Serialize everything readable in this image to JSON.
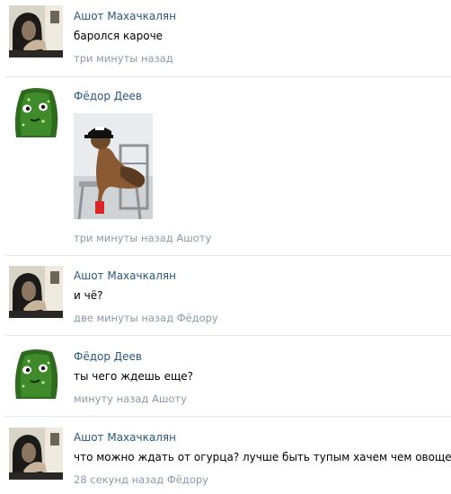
{
  "comments": [
    {
      "author": "Ашот Махачкалян",
      "text": "баролся кароче",
      "time": "три минуты назад",
      "reply_to": "",
      "avatar_icon": "man-dark-photo-avatar"
    },
    {
      "author": "Фёдор Деев",
      "text": "",
      "attachment_icon": "cat-in-cap-on-chair-photo",
      "time": "три минуты назад",
      "reply_to": "Ашоту",
      "avatar_icon": "cucumber-face-avatar"
    },
    {
      "author": "Ашот Махачкалян",
      "text": "и чё?",
      "time": "две минуты назад",
      "reply_to": "Фёдору",
      "avatar_icon": "man-dark-photo-avatar"
    },
    {
      "author": "Фёдор Деев",
      "text": "ты чего ждешь еще?",
      "time": "минуту назад",
      "reply_to": "Ашоту",
      "avatar_icon": "cucumber-face-avatar"
    },
    {
      "author": "Ашот Махачкалян",
      "text": "что можно ждать от огурца? лучше быть тупым хачем чем овощем",
      "time": "28 секунд назад",
      "reply_to": "Фёдору",
      "avatar_icon": "man-dark-photo-avatar"
    }
  ],
  "colors": {
    "author_link": "#2b587a",
    "meta_text": "#8b9aac",
    "divider": "#e7e8ec"
  }
}
